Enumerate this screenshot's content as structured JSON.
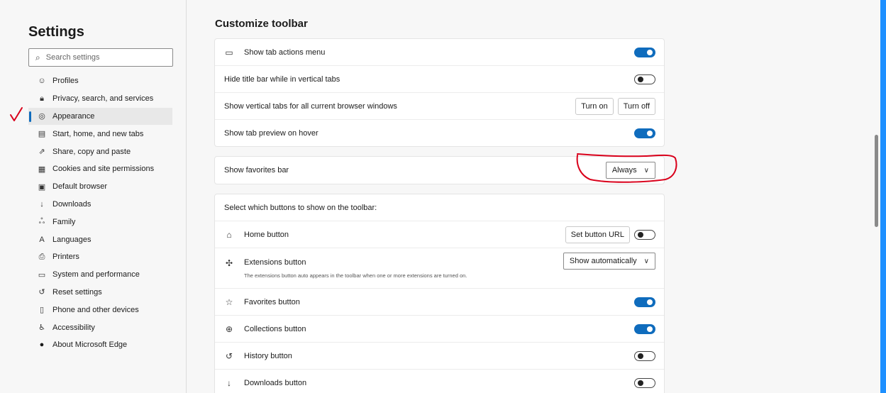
{
  "sidebar": {
    "title": "Settings",
    "search_placeholder": "Search settings",
    "items": [
      {
        "label": "Profiles",
        "icon": "profile-icon",
        "glyph": "☺",
        "active": false
      },
      {
        "label": "Privacy, search, and services",
        "icon": "lock-icon",
        "glyph": "🔒︎",
        "active": false
      },
      {
        "label": "Appearance",
        "icon": "palette-icon",
        "glyph": "◎",
        "active": true
      },
      {
        "label": "Start, home, and new tabs",
        "icon": "window-icon",
        "glyph": "▤",
        "active": false
      },
      {
        "label": "Share, copy and paste",
        "icon": "share-icon",
        "glyph": "⇗",
        "active": false
      },
      {
        "label": "Cookies and site permissions",
        "icon": "cookies-icon",
        "glyph": "▦",
        "active": false
      },
      {
        "label": "Default browser",
        "icon": "browser-icon",
        "glyph": "▣",
        "active": false
      },
      {
        "label": "Downloads",
        "icon": "download-icon",
        "glyph": "↓",
        "active": false
      },
      {
        "label": "Family",
        "icon": "family-icon",
        "glyph": "ஃ",
        "active": false
      },
      {
        "label": "Languages",
        "icon": "languages-icon",
        "glyph": "A",
        "active": false
      },
      {
        "label": "Printers",
        "icon": "printer-icon",
        "glyph": "⎙",
        "active": false
      },
      {
        "label": "System and performance",
        "icon": "laptop-icon",
        "glyph": "▭",
        "active": false
      },
      {
        "label": "Reset settings",
        "icon": "reset-icon",
        "glyph": "↺",
        "active": false
      },
      {
        "label": "Phone and other devices",
        "icon": "phone-icon",
        "glyph": "▯",
        "active": false
      },
      {
        "label": "Accessibility",
        "icon": "accessibility-icon",
        "glyph": "♿︎",
        "active": false
      },
      {
        "label": "About Microsoft Edge",
        "icon": "edge-logo-icon",
        "glyph": "●",
        "active": false
      }
    ]
  },
  "main": {
    "section_title": "Customize toolbar",
    "card1": [
      {
        "label": "Show tab actions menu",
        "icon": "tab-actions-icon",
        "glyph": "▭",
        "toggle": "on"
      },
      {
        "label": "Hide title bar while in vertical tabs",
        "toggle": "off"
      },
      {
        "label": "Show vertical tabs for all current browser windows",
        "btn_on": "Turn on",
        "btn_off": "Turn off"
      },
      {
        "label": "Show tab preview on hover",
        "toggle": "on"
      }
    ],
    "favorites_bar": {
      "label": "Show favorites bar",
      "value": "Always"
    },
    "card3": {
      "header": "Select which buttons to show on the toolbar:",
      "home": {
        "label": "Home button",
        "icon": "home-icon",
        "glyph": "⌂",
        "button": "Set button URL",
        "toggle": "off"
      },
      "extensions": {
        "label": "Extensions button",
        "icon": "puzzle-icon",
        "glyph": "✣",
        "value": "Show automatically",
        "subtext": "The extensions button auto appears in the toolbar when one or more extensions are turned on."
      },
      "favorites": {
        "label": "Favorites button",
        "icon": "favorites-icon",
        "glyph": "☆",
        "toggle": "on"
      },
      "collections": {
        "label": "Collections button",
        "icon": "collections-icon",
        "glyph": "⊕",
        "toggle": "on"
      },
      "history": {
        "label": "History button",
        "icon": "history-icon",
        "glyph": "↺",
        "toggle": "off"
      },
      "downloads": {
        "label": "Downloads button",
        "icon": "download-icon",
        "glyph": "↓",
        "toggle": "off"
      }
    }
  },
  "colors": {
    "accent": "#0f6cbd",
    "annotation_red": "#d9001b",
    "edge_bar": "#1e90ff"
  }
}
